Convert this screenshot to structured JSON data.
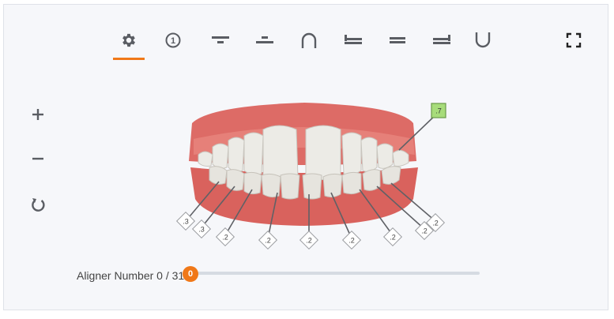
{
  "toolbar": {
    "tools": [
      {
        "name": "settings",
        "icon": "gear-icon"
      },
      {
        "name": "step",
        "icon": "circle-one-icon",
        "label": "1"
      },
      {
        "name": "upper-view",
        "icon": "upper-view-icon"
      },
      {
        "name": "lower-view",
        "icon": "lower-view-icon"
      },
      {
        "name": "upper-arch",
        "icon": "upper-arch-icon"
      },
      {
        "name": "left-view",
        "icon": "left-view-icon"
      },
      {
        "name": "front-view",
        "icon": "front-view-icon"
      },
      {
        "name": "right-view",
        "icon": "right-view-icon"
      },
      {
        "name": "lower-arch",
        "icon": "lower-arch-icon"
      },
      {
        "name": "fullscreen",
        "icon": "fullscreen-icon"
      }
    ],
    "active": "settings",
    "accent": "#f07818"
  },
  "zoom": {
    "in_icon": "plus-icon",
    "out_icon": "minus-icon",
    "reset_icon": "rotate-icon"
  },
  "teeth_labels": {
    "upper": [
      ".7"
    ],
    "lower": [
      ".3",
      ".3",
      ".2",
      ".2",
      ".2",
      ".2",
      ".2",
      ".2",
      ".2"
    ]
  },
  "slider": {
    "label": "Aligner Number 0 / 31",
    "value": "0",
    "current": 0,
    "max": 31
  }
}
